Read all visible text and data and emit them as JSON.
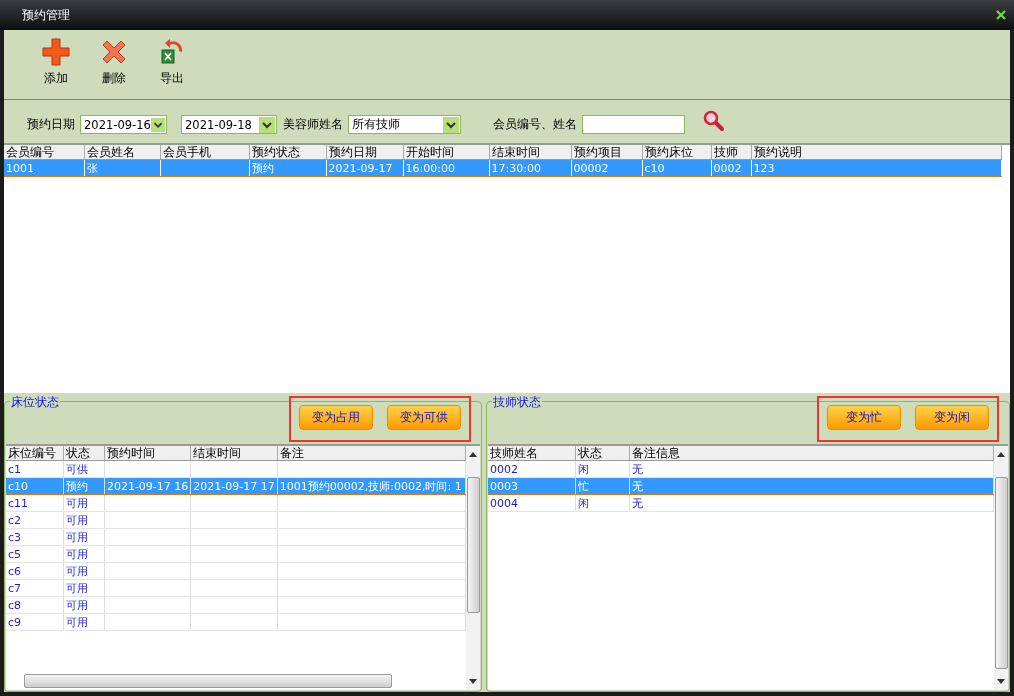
{
  "window": {
    "title": "预约管理"
  },
  "toolbar": [
    {
      "kind": "add",
      "label": "添加"
    },
    {
      "kind": "delete",
      "label": "删除"
    },
    {
      "kind": "export",
      "label": "导出"
    }
  ],
  "filters": {
    "date_label": "预约日期",
    "date_from": "2021-09-16",
    "date_to": "2021-09-18",
    "beautician_label": "美容师姓名",
    "beautician": "所有技师",
    "member_label": "会员编号、姓名"
  },
  "appointments": {
    "columns": [
      "会员编号",
      "会员姓名",
      "会员手机",
      "预约状态",
      "预约日期",
      "开始时间",
      "结束时间",
      "预约项目",
      "预约床位",
      "技师",
      "预约说明"
    ],
    "rows": [
      {
        "cells": [
          "1001",
          "张",
          "",
          "预约",
          "2021-09-17",
          "16:00:00",
          "17:30:00",
          "00002",
          "c10",
          "0002",
          "123"
        ],
        "selected": true
      }
    ]
  },
  "bed_panel": {
    "title": "床位状态",
    "buttons": [
      "变为占用",
      "变为可供"
    ],
    "columns": [
      "床位编号",
      "状态",
      "预约时间",
      "结束时间",
      "备注"
    ],
    "rows": [
      {
        "cells": [
          "c1",
          "可供",
          "",
          "",
          ""
        ],
        "selected": false
      },
      {
        "cells": [
          "c10",
          "预约",
          "2021-09-17 16",
          "2021-09-17 17",
          "1001预约00002,技师:0002,时间: 1"
        ],
        "selected": true
      },
      {
        "cells": [
          "c11",
          "可用",
          "",
          "",
          ""
        ],
        "selected": false
      },
      {
        "cells": [
          "c2",
          "可用",
          "",
          "",
          ""
        ],
        "selected": false
      },
      {
        "cells": [
          "c3",
          "可用",
          "",
          "",
          ""
        ],
        "selected": false
      },
      {
        "cells": [
          "c5",
          "可用",
          "",
          "",
          ""
        ],
        "selected": false
      },
      {
        "cells": [
          "c6",
          "可用",
          "",
          "",
          ""
        ],
        "selected": false
      },
      {
        "cells": [
          "c7",
          "可用",
          "",
          "",
          ""
        ],
        "selected": false
      },
      {
        "cells": [
          "c8",
          "可用",
          "",
          "",
          ""
        ],
        "selected": false
      },
      {
        "cells": [
          "c9",
          "可用",
          "",
          "",
          ""
        ],
        "selected": false
      }
    ]
  },
  "tech_panel": {
    "title": "技师状态",
    "buttons": [
      "变为忙",
      "变为闲"
    ],
    "columns": [
      "技师姓名",
      "状态",
      "备注信息"
    ],
    "rows": [
      {
        "cells": [
          "0002",
          "闲",
          "无"
        ],
        "selected": false
      },
      {
        "cells": [
          "0003",
          "忙",
          "无"
        ],
        "selected": true
      },
      {
        "cells": [
          "0004",
          "闲",
          "无"
        ],
        "selected": false
      }
    ]
  }
}
